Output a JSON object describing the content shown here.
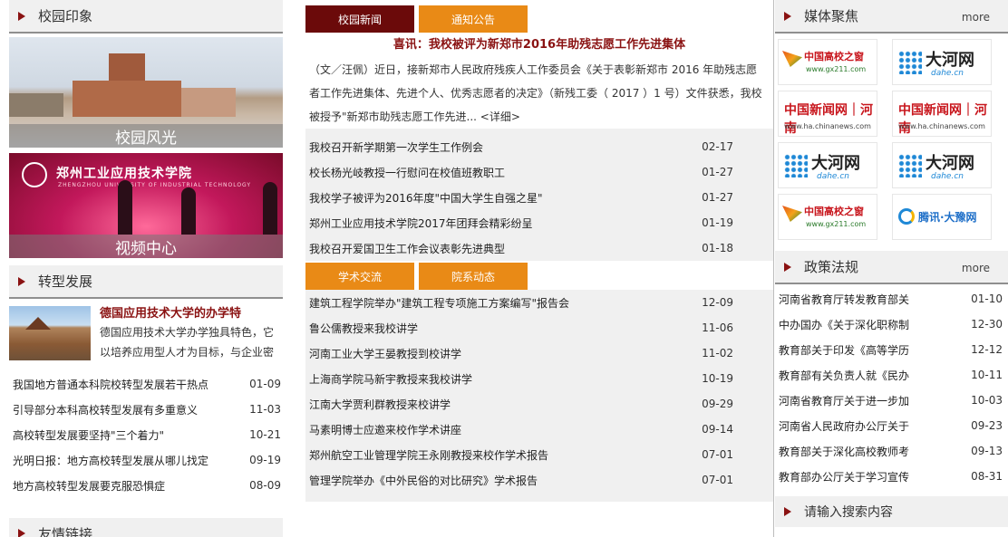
{
  "left": {
    "impression_title": "校园印象",
    "banner1_caption": "校园风光",
    "banner2_caption": "视频中心",
    "banner2_logo": "郑州工业应用技术学院",
    "banner2_logo_en": "ZHENGZHOU UNIVERSITY OF INDUSTRIAL TECHNOLOGY",
    "transform_title": "转型发展",
    "feature_title": "德国应用技术大学的办学特",
    "feature_body": "德国应用技术大学办学独具特色，它以培养应用型人才为目标，与企业密",
    "transform_items": [
      {
        "title": "我国地方普通本科院校转型发展若干热点",
        "date": "01-09"
      },
      {
        "title": "引导部分本科高校转型发展有多重意义",
        "date": "11-03"
      },
      {
        "title": "高校转型发展要坚持\"三个着力\"",
        "date": "10-21"
      },
      {
        "title": "光明日报：地方高校转型发展从哪儿找定",
        "date": "09-19"
      },
      {
        "title": "地方高校转型发展要克服恐惧症",
        "date": "08-09"
      }
    ],
    "links_title": "友情链接"
  },
  "mid": {
    "tab1": "校园新闻",
    "tab2": "通知公告",
    "headline": "喜讯：我校被评为新郑市2016年助残志愿工作先进集体",
    "summary": "（文／汪佩）近日，接新郑市人民政府残疾人工作委员会《关于表彰新郑市 2016 年助残志愿者工作先进集体、先进个人、优秀志愿者的决定》（新残工委（ 2017 ）1 号）文件获悉，我校被授予\"新郑市助残志愿工作先进... <详细>",
    "news": [
      {
        "title": "我校召开新学期第一次学生工作例会",
        "date": "02-17"
      },
      {
        "title": "校长杨光岐教授一行慰问在校值班教职工",
        "date": "01-27"
      },
      {
        "title": "我校学子被评为2016年度\"中国大学生自强之星\"",
        "date": "01-27"
      },
      {
        "title": "郑州工业应用技术学院2017年团拜会精彩纷呈",
        "date": "01-19"
      },
      {
        "title": "我校召开爱国卫生工作会议表彰先进典型",
        "date": "01-18"
      }
    ],
    "tab3": "学术交流",
    "tab4": "院系动态",
    "academic": [
      {
        "title": "建筑工程学院举办\"建筑工程专项施工方案编写\"报告会",
        "date": "12-09"
      },
      {
        "title": "鲁公儒教授来我校讲学",
        "date": "11-06"
      },
      {
        "title": "河南工业大学王晏教授到校讲学",
        "date": "11-02"
      },
      {
        "title": "上海商学院马新宇教授来我校讲学",
        "date": "10-19"
      },
      {
        "title": "江南大学贾利群教授来校讲学",
        "date": "09-29"
      },
      {
        "title": "马素明博士应邀来校作学术讲座",
        "date": "09-14"
      },
      {
        "title": "郑州航空工业管理学院王永刚教授来校作学术报告",
        "date": "07-01"
      },
      {
        "title": "管理学院举办《中外民俗的对比研究》学术报告",
        "date": "07-01"
      }
    ]
  },
  "right": {
    "media_title": "媒体聚焦",
    "media_more": "more",
    "media": [
      {
        "type": "gx",
        "name": "中国高校之窗",
        "url": "www.gx211.com"
      },
      {
        "type": "dh",
        "name": "大河网",
        "url": "dahe.cn"
      },
      {
        "type": "cn",
        "name": "中国新闻网｜河南",
        "url": "www.ha.chinanews.com"
      },
      {
        "type": "cn",
        "name": "中国新闻网｜河南",
        "url": "www.ha.chinanews.com"
      },
      {
        "type": "dh",
        "name": "大河网",
        "url": "dahe.cn"
      },
      {
        "type": "dh",
        "name": "大河网",
        "url": "dahe.cn"
      },
      {
        "type": "gx",
        "name": "中国高校之窗",
        "url": "www.gx211.com"
      },
      {
        "type": "tx",
        "name": "腾讯·大豫网",
        "url": ""
      }
    ],
    "policy_title": "政策法规",
    "policy_more": "more",
    "policy": [
      {
        "title": "河南省教育厅转发教育部关",
        "date": "01-10"
      },
      {
        "title": "中办国办《关于深化职称制",
        "date": "12-30"
      },
      {
        "title": "教育部关于印发《高等学历",
        "date": "12-12"
      },
      {
        "title": "教育部有关负责人就《民办",
        "date": "10-11"
      },
      {
        "title": "河南省教育厅关于进一步加",
        "date": "10-03"
      },
      {
        "title": "河南省人民政府办公厅关于",
        "date": "09-23"
      },
      {
        "title": "教育部关于深化高校教师考",
        "date": "09-13"
      },
      {
        "title": "教育部办公厅关于学习宣传",
        "date": "08-31"
      }
    ],
    "search_label": "请输入搜索内容"
  },
  "colors": {
    "accent": "#8a1212",
    "tab_dark": "#6b0a0a",
    "tab_orange": "#e98a16",
    "panel": "#f0f0f0"
  }
}
